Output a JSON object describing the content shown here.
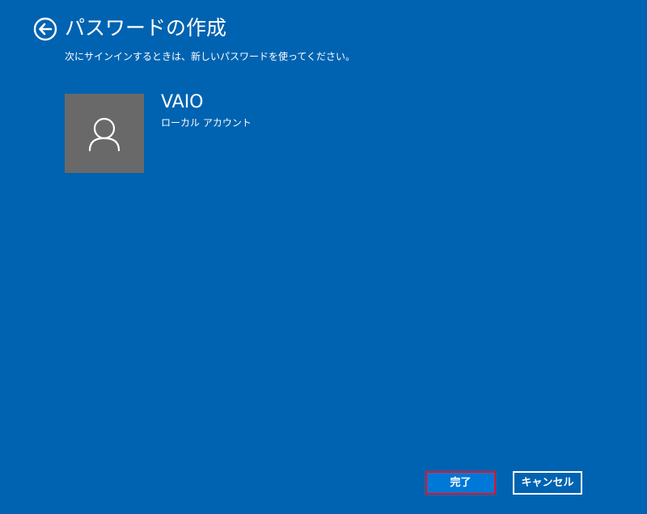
{
  "header": {
    "back_icon": "back-arrow-circle-icon",
    "title": "パスワードの作成",
    "subtitle": "次にサインインするときは、新しいパスワードを使ってください。"
  },
  "account": {
    "avatar_icon": "user-person-icon",
    "name": "VAIO",
    "type": "ローカル アカウント"
  },
  "buttons": {
    "finish_label": "完了",
    "cancel_label": "キャンセル"
  },
  "colors": {
    "background": "#0063b1",
    "avatar_bg": "#696969",
    "primary_button": "#0078d7",
    "focus_border": "#e81123",
    "text": "#ffffff"
  }
}
